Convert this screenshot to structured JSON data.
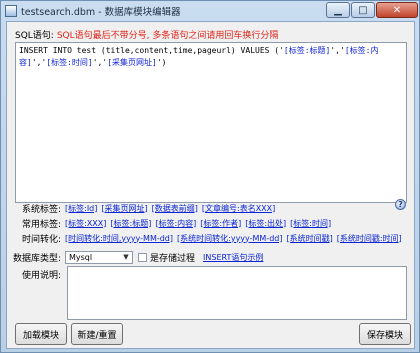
{
  "window": {
    "title": "testsearch.dbm - 数据库模块编辑器",
    "minimize_glyph": "▁",
    "maximize_glyph": "□",
    "close_glyph": "✕"
  },
  "notice": {
    "label": "SQL语句:",
    "text": "SQL语句最后不带分号, 多条语句之间请用回车换行分隔"
  },
  "sql": {
    "prefix": "INSERT INTO test (title,content,time,pageurl) VALUES ('",
    "tag1": "[标签:标题]",
    "sep1": "','",
    "tag2": "[标签:内容]",
    "sep2": "','",
    "tag3": "[标签:时间]",
    "sep3": "','",
    "tag4": "[采集页网址]",
    "suffix": "')"
  },
  "system_tags": {
    "label": "系统标签:",
    "items": [
      "[标签:Id]",
      "[采集页网址]",
      "[数据表前缀]",
      "[文章编号:表名XXX]"
    ]
  },
  "common_tags": {
    "label": "常用标签:",
    "items": [
      "[标签:XXX]",
      "[标签:标题]",
      "[标签:内容]",
      "[标签:作者]",
      "[标签:出处]",
      "[标签:时间]"
    ]
  },
  "time_convert": {
    "label": "时间转化:",
    "items": [
      "[时间转化:时间,yyyy-MM-dd]",
      "[系统时间转化:yyyy-MM-dd]",
      "[系统时间戳]",
      "[系统时间戳:时间]"
    ]
  },
  "db_type": {
    "label": "数据库类型:",
    "selected": "Mysql",
    "stored_procedure_label": "是存储过程",
    "insert_example_link": "INSERT语句示例"
  },
  "usage": {
    "label": "使用说明:",
    "value": ""
  },
  "buttons": {
    "load": "加载模块",
    "new_reset": "新建/重置",
    "save": "保存模块"
  },
  "help_glyph": "?"
}
